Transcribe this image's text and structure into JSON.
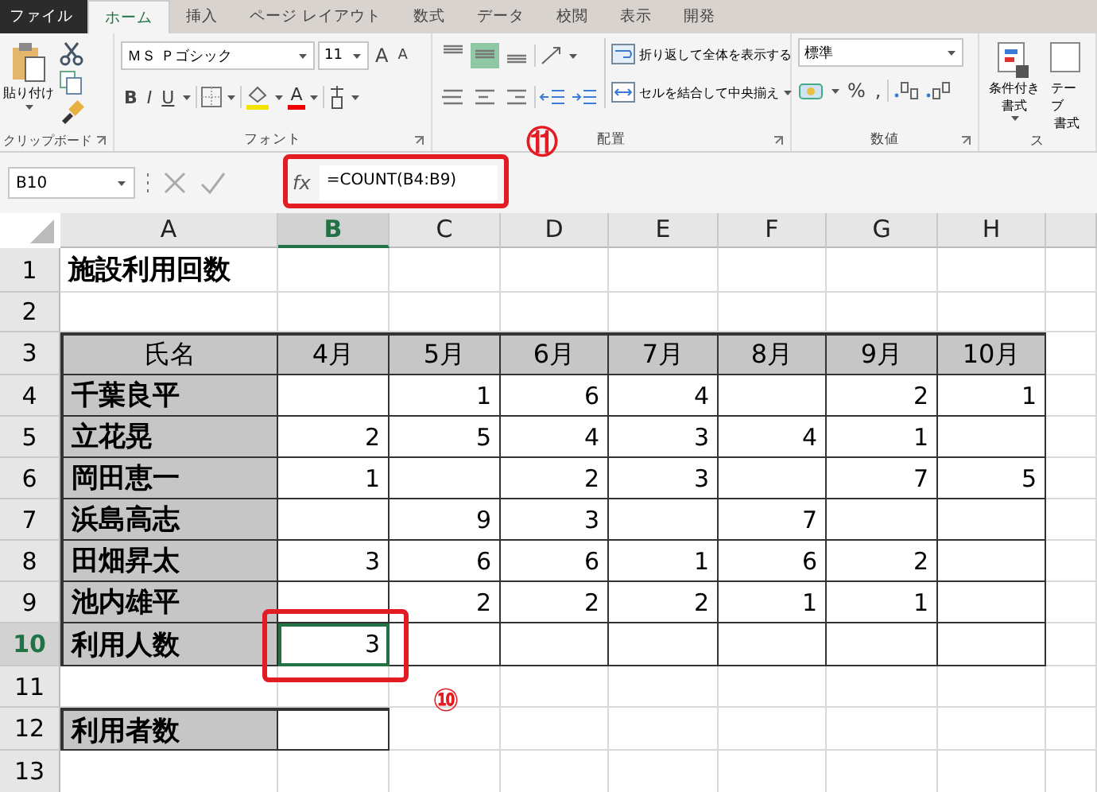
{
  "tabs": [
    {
      "label": "ファイル",
      "kind": "file",
      "selected": false
    },
    {
      "label": "ホーム",
      "kind": "tab",
      "selected": true
    },
    {
      "label": "挿入",
      "kind": "tab",
      "selected": false
    },
    {
      "label": "ページ レイアウト",
      "kind": "tab",
      "selected": false
    },
    {
      "label": "数式",
      "kind": "tab",
      "selected": false
    },
    {
      "label": "データ",
      "kind": "tab",
      "selected": false
    },
    {
      "label": "校閲",
      "kind": "tab",
      "selected": false
    },
    {
      "label": "表示",
      "kind": "tab",
      "selected": false
    },
    {
      "label": "開発",
      "kind": "tab",
      "selected": false
    }
  ],
  "ribbon": {
    "clipboard": {
      "label": "クリップボード",
      "paste": "貼り付け"
    },
    "font": {
      "label": "フォント",
      "font_name": "ＭＳ Ｐゴシック",
      "font_size": "11",
      "grow": "A",
      "shrink": "A",
      "bold": "B",
      "italic": "I",
      "underline": "U",
      "font_color": "A"
    },
    "alignment": {
      "label": "配置",
      "vertical": [
        {
          "selected": false
        },
        {
          "selected": true
        },
        {
          "selected": false
        }
      ],
      "wrap": "折り返して全体を表示する",
      "merge": "セルを結合して中央揃え"
    },
    "number": {
      "label": "数値",
      "format": "標準",
      "percent": "%",
      "comma": ","
    },
    "styles": {
      "label": "ス",
      "conditional": [
        "条件付き",
        "書式"
      ],
      "table": [
        "テーブ",
        "書式"
      ]
    }
  },
  "formula_bar": {
    "name_box": "B10",
    "fx": "fx",
    "formula": "=COUNT(B4:B9)"
  },
  "annotations": [
    {
      "kind": "circle",
      "text": "⑪"
    },
    {
      "kind": "circle",
      "text": "⑩"
    }
  ],
  "sheet": {
    "columns": [
      {
        "label": "A",
        "selected": false
      },
      {
        "label": "B",
        "selected": true
      },
      {
        "label": "C",
        "selected": false
      },
      {
        "label": "D",
        "selected": false
      },
      {
        "label": "E",
        "selected": false
      },
      {
        "label": "F",
        "selected": false
      },
      {
        "label": "G",
        "selected": false
      },
      {
        "label": "H",
        "selected": false
      }
    ],
    "rows": [
      {
        "header": "1",
        "kind": "title",
        "selected": false,
        "cells": [
          "施設利用回数"
        ]
      },
      {
        "header": "2",
        "kind": "blank",
        "selected": false
      },
      {
        "header": "3",
        "kind": "table-head",
        "selected": false,
        "cells": [
          "氏名",
          "4月",
          "5月",
          "6月",
          "7月",
          "8月",
          "9月",
          "10月"
        ]
      },
      {
        "header": "4",
        "kind": "table-row",
        "selected": false,
        "cells": [
          "千葉良平",
          null,
          "1",
          "6",
          "4",
          null,
          "2",
          "1"
        ]
      },
      {
        "header": "5",
        "kind": "table-row",
        "selected": false,
        "cells": [
          "立花晃",
          "2",
          "5",
          "4",
          "3",
          "4",
          "1",
          null
        ]
      },
      {
        "header": "6",
        "kind": "table-row",
        "selected": false,
        "cells": [
          "岡田恵一",
          "1",
          null,
          "2",
          "3",
          null,
          "7",
          "5"
        ]
      },
      {
        "header": "7",
        "kind": "table-row",
        "selected": false,
        "cells": [
          "浜島高志",
          null,
          "9",
          "3",
          null,
          "7",
          null,
          null
        ]
      },
      {
        "header": "8",
        "kind": "table-row",
        "selected": false,
        "cells": [
          "田畑昇太",
          "3",
          "6",
          "6",
          "1",
          "6",
          "2",
          null
        ]
      },
      {
        "header": "9",
        "kind": "table-row",
        "selected": false,
        "cells": [
          "池内雄平",
          null,
          "2",
          "2",
          "2",
          "1",
          "1",
          null
        ]
      },
      {
        "header": "10",
        "kind": "table-row",
        "selected": true,
        "cells": [
          "利用人数",
          "3",
          null,
          null,
          null,
          null,
          null,
          null
        ]
      },
      {
        "header": "11",
        "kind": "blank",
        "selected": false
      },
      {
        "header": "12",
        "kind": "summary",
        "selected": false,
        "cells": [
          "利用者数",
          null
        ]
      },
      {
        "header": "13",
        "kind": "blank",
        "selected": false
      }
    ]
  }
}
